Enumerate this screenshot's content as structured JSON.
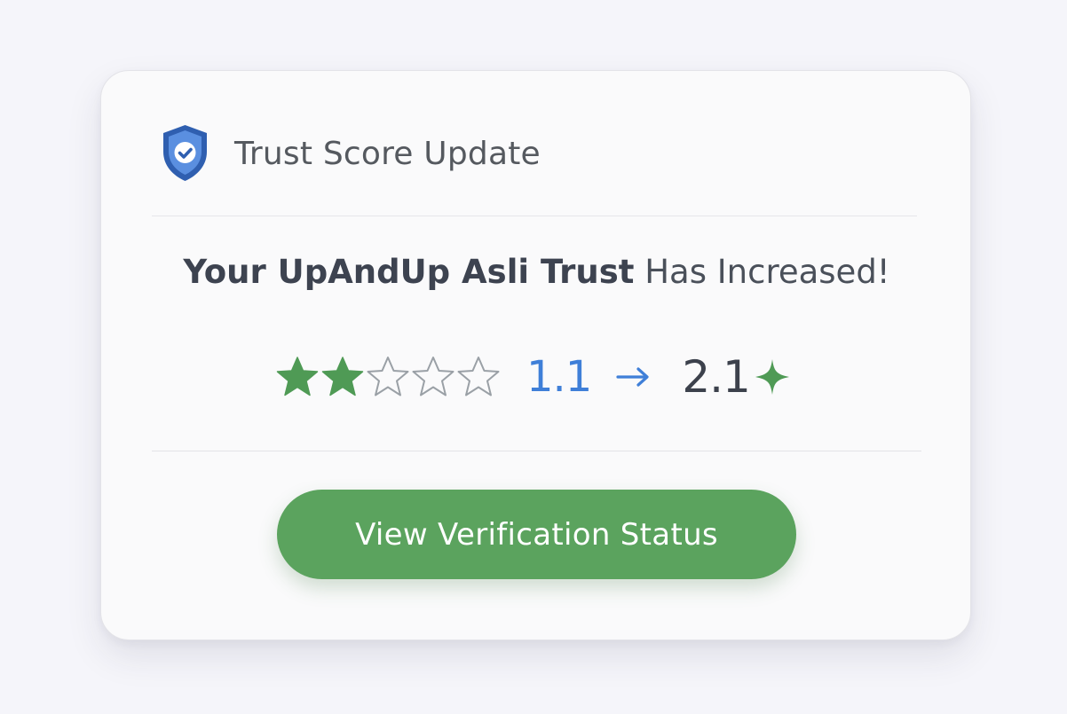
{
  "card": {
    "title": "Trust Score Update",
    "headline_bold": "Your UpAndUp Asli Trust",
    "headline_rest": " Has Increased!",
    "rating": {
      "filled_stars": 2,
      "total_stars": 5,
      "old_score": "1.1",
      "new_score": "2.1"
    },
    "button_label": "View Verification Status"
  },
  "colors": {
    "shield": "#2f5fb0",
    "star_filled": "#4f9a55",
    "star_outline": "#9aa0a6",
    "old_score": "#3f7fd8",
    "new_score": "#3c414c",
    "sparkle": "#4f9a55",
    "button": "#5ba35e"
  },
  "icons": {
    "header": "shield-check-icon",
    "arrow": "arrow-right-icon",
    "sparkle": "sparkle-icon"
  }
}
